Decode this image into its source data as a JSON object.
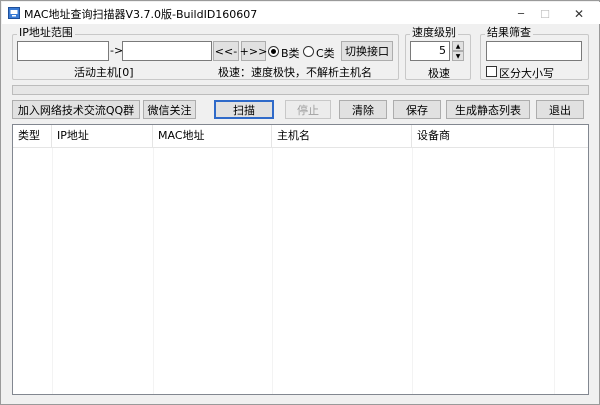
{
  "window": {
    "title": "MAC地址查询扫描器V3.7.0版-BuildID160607",
    "minimize_glyph": "─",
    "maximize_glyph": "☐",
    "close_glyph": "✕"
  },
  "ip_range": {
    "group_label": "IP地址范围",
    "start_ip_value": "",
    "separator": "->",
    "end_ip_value": "",
    "prev_button": "<<-",
    "next_button": "+>>",
    "class_b_label": "B类",
    "class_c_label": "C类",
    "selected_class": "B",
    "switch_interface_button": "切换接口",
    "active_hosts_label": "活动主机[0]",
    "speed_desc": "极速：速度极快，不解析主机名"
  },
  "speed": {
    "group_label": "速度级别",
    "value": "5",
    "level_label": "极速"
  },
  "filter": {
    "group_label": "结果筛查",
    "value": "",
    "case_sensitive_label": "区分大小写",
    "case_sensitive_checked": false
  },
  "progress": {
    "value": 0
  },
  "toolbar": {
    "qq_group_button": "加入网络技术交流QQ群",
    "wechat_button": "微信关注",
    "scan_button": "扫描",
    "stop_button": "停止",
    "clear_button": "清除",
    "save_button": "保存",
    "static_list_button": "生成静态列表",
    "exit_button": "退出"
  },
  "results_table": {
    "columns": [
      "类型",
      "IP地址",
      "MAC地址",
      "主机名",
      "设备商"
    ],
    "rows": []
  },
  "icons": {
    "app": "app-icon",
    "spin_up": "▲",
    "spin_down": "▼"
  }
}
